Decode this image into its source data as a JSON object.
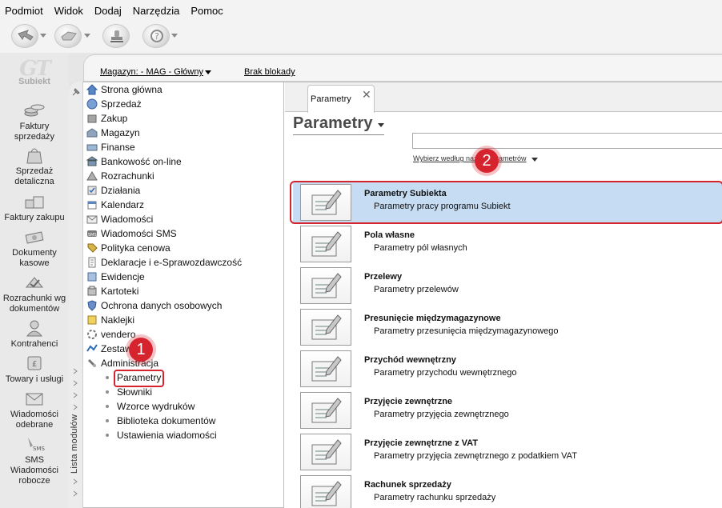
{
  "menu": [
    "Podmiot",
    "Widok",
    "Dodaj",
    "Narzędzia",
    "Pomoc"
  ],
  "toolbar": {
    "icons": [
      "back-arrow-icon",
      "forward-arrow-icon",
      "stamp-icon",
      "help-icon"
    ]
  },
  "logo": {
    "mark": "GT",
    "name": "Subiekt"
  },
  "rail": [
    {
      "label": "Faktury sprzedaży",
      "icon": "coins-icon"
    },
    {
      "label": "Sprzedaż detaliczna",
      "icon": "shopping-bag-icon"
    },
    {
      "label": "Faktury zakupu",
      "icon": "boxes-icon"
    },
    {
      "label": "Dokumenty kasowe",
      "icon": "cash-icon"
    },
    {
      "label": "Rozrachunki wg dokumentów",
      "icon": "settlements-icon"
    },
    {
      "label": "Kontrahenci",
      "icon": "person-icon"
    },
    {
      "label": "Towary i usługi",
      "icon": "goods-icon"
    },
    {
      "label": "Wiadomości odebrane",
      "icon": "envelope-icon"
    },
    {
      "label": "SMS Wiadomości robocze",
      "icon": "sms-icon",
      "badge": "SMS"
    }
  ],
  "header": {
    "magazyn": "Magazyn: - MAG - Główny",
    "blokady": "Brak blokady"
  },
  "modules_strip_label": "Lista modułów",
  "modules": [
    {
      "label": "Strona główna",
      "icon": "home-icon"
    },
    {
      "label": "Sprzedaż",
      "icon": "sales-icon"
    },
    {
      "label": "Zakup",
      "icon": "purchase-icon"
    },
    {
      "label": "Magazyn",
      "icon": "warehouse-icon"
    },
    {
      "label": "Finanse",
      "icon": "finance-icon"
    },
    {
      "label": "Bankowość on-line",
      "icon": "bank-icon"
    },
    {
      "label": "Rozrachunki",
      "icon": "settlements-icon"
    },
    {
      "label": "Działania",
      "icon": "actions-icon"
    },
    {
      "label": "Kalendarz",
      "icon": "calendar-icon"
    },
    {
      "label": "Wiadomości",
      "icon": "messages-icon"
    },
    {
      "label": "Wiadomości SMS",
      "icon": "sms-icon"
    },
    {
      "label": "Polityka cenowa",
      "icon": "price-icon"
    },
    {
      "label": "Deklaracje i e-Sprawozdawczość",
      "icon": "declaration-icon"
    },
    {
      "label": "Ewidencje",
      "icon": "records-icon"
    },
    {
      "label": "Kartoteki",
      "icon": "files-icon"
    },
    {
      "label": "Ochrona danych osobowych",
      "icon": "shield-icon"
    },
    {
      "label": "Naklejki",
      "icon": "label-icon"
    },
    {
      "label": "vendero",
      "icon": "vendero-icon"
    },
    {
      "label": "Zestawienia",
      "icon": "reports-icon"
    },
    {
      "label": "Administracja",
      "icon": "admin-icon"
    }
  ],
  "submodules": [
    {
      "label": "Parametry",
      "selected": true
    },
    {
      "label": "Słowniki"
    },
    {
      "label": "Wzorce wydruków"
    },
    {
      "label": "Biblioteka dokumentów"
    },
    {
      "label": "Ustawienia wiadomości"
    }
  ],
  "tab": {
    "label": "Parametry",
    "close": "✕"
  },
  "page_title": "Parametry",
  "search": {
    "value": ""
  },
  "filter_label": "Wybierz według nazwy parametrów",
  "badges": {
    "one": "1",
    "two": "2"
  },
  "params": [
    {
      "title": "Parametry Subiekta",
      "desc": "Parametry pracy programu Subiekt",
      "selected": true
    },
    {
      "title": "Pola własne",
      "desc": "Parametry pól własnych"
    },
    {
      "title": "Przelewy",
      "desc": "Parametry przelewów"
    },
    {
      "title": "Presunięcie międzymagazynowe",
      "desc": "Parametry przesunięcia międzymagazynowego"
    },
    {
      "title": "Przychód wewnętrzny",
      "desc": "Parametry przychodu wewnętrznego"
    },
    {
      "title": "Przyjęcie zewnętrzne",
      "desc": "Parametry przyjęcia zewnętrznego"
    },
    {
      "title": "Przyjęcie zewnętrzne z VAT",
      "desc": "Parametry przyjęcia zewnętrznego z podatkiem VAT"
    },
    {
      "title": "Rachunek sprzedaży",
      "desc": "Parametry rachunku sprzedaży"
    }
  ],
  "colors": {
    "accent_red": "#d6242f",
    "selection_blue": "#c6dcf2"
  }
}
